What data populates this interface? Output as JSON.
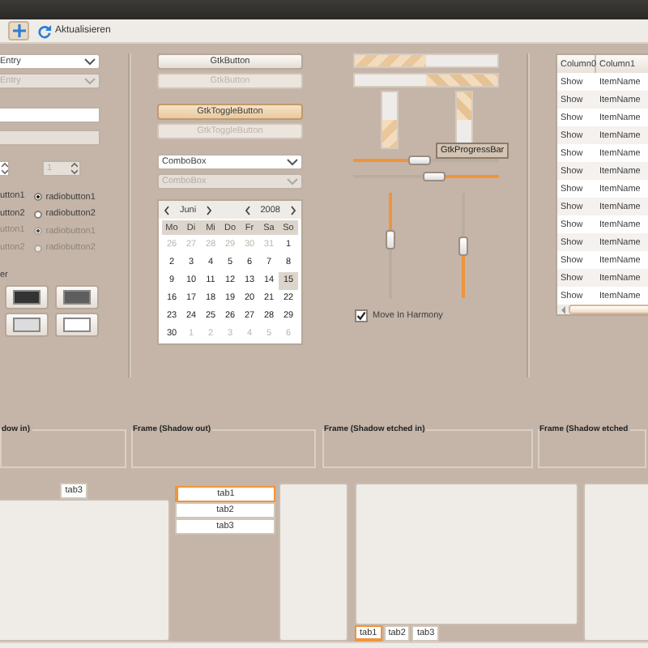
{
  "toolbar": [
    {
      "kind": "add",
      "selected": true
    },
    {
      "kind": "refresh",
      "label": "Aktualisieren",
      "selected": false
    }
  ],
  "combo_entries": [
    {
      "value": "Entry",
      "disabled": false
    },
    {
      "value": "Entry",
      "disabled": true
    }
  ],
  "entries": [
    {
      "disabled": false
    },
    {
      "disabled": true
    }
  ],
  "spin_buttons": [
    {
      "disabled": false
    },
    {
      "value": "1",
      "disabled": true
    }
  ],
  "check_labels": [
    {
      "label": "utton1",
      "disabled": false
    },
    {
      "label": "utton2",
      "disabled": false
    },
    {
      "label": "utton1",
      "disabled": true
    },
    {
      "label": "utton2",
      "disabled": true
    }
  ],
  "radios": [
    {
      "label": "radiobutton1",
      "selected": true,
      "disabled": false
    },
    {
      "label": "radiobutton2",
      "selected": false,
      "disabled": false
    },
    {
      "label": "radiobutton1",
      "selected": true,
      "disabled": true
    },
    {
      "label": "radiobutton2",
      "selected": false,
      "disabled": true
    }
  ],
  "color_label": "er",
  "swatches": [
    {
      "color": "#333333"
    },
    {
      "color": "#5e5e5e"
    },
    {
      "color": "#dcdcdc"
    },
    {
      "color": "#ffffff"
    }
  ],
  "buttons": [
    {
      "kind": "button",
      "label": "GtkButton",
      "disabled": false
    },
    {
      "kind": "button",
      "label": "GtkButton",
      "disabled": true
    },
    {
      "kind": "toggle",
      "label": "GtkToggleButton",
      "disabled": false,
      "selected": true
    },
    {
      "kind": "toggle",
      "label": "GtkToggleButton",
      "disabled": true,
      "selected": false
    }
  ],
  "combos": [
    {
      "value": "ComboBox",
      "disabled": false
    },
    {
      "value": "ComboBox",
      "disabled": true
    }
  ],
  "calendar": {
    "month": "Juni",
    "year": "2008",
    "weekdays": [
      "Mo",
      "Di",
      "Mi",
      "Do",
      "Fr",
      "Sa",
      "So"
    ],
    "days": [
      {
        "day": "26",
        "outside": true,
        "selected": false
      },
      {
        "day": "27",
        "outside": true,
        "selected": false
      },
      {
        "day": "28",
        "outside": true,
        "selected": false
      },
      {
        "day": "29",
        "outside": true,
        "selected": false
      },
      {
        "day": "30",
        "outside": true,
        "selected": false
      },
      {
        "day": "31",
        "outside": true,
        "selected": false
      },
      {
        "day": "1",
        "outside": false,
        "selected": false
      },
      {
        "day": "2",
        "outside": false,
        "selected": false
      },
      {
        "day": "3",
        "outside": false,
        "selected": false
      },
      {
        "day": "4",
        "outside": false,
        "selected": false
      },
      {
        "day": "5",
        "outside": false,
        "selected": false
      },
      {
        "day": "6",
        "outside": false,
        "selected": false
      },
      {
        "day": "7",
        "outside": false,
        "selected": false
      },
      {
        "day": "8",
        "outside": false,
        "selected": false
      },
      {
        "day": "9",
        "outside": false,
        "selected": false
      },
      {
        "day": "10",
        "outside": false,
        "selected": false
      },
      {
        "day": "11",
        "outside": false,
        "selected": false
      },
      {
        "day": "12",
        "outside": false,
        "selected": false
      },
      {
        "day": "13",
        "outside": false,
        "selected": false
      },
      {
        "day": "14",
        "outside": false,
        "selected": false
      },
      {
        "day": "15",
        "outside": false,
        "selected": true
      },
      {
        "day": "16",
        "outside": false,
        "selected": false
      },
      {
        "day": "17",
        "outside": false,
        "selected": false
      },
      {
        "day": "18",
        "outside": false,
        "selected": false
      },
      {
        "day": "19",
        "outside": false,
        "selected": false
      },
      {
        "day": "20",
        "outside": false,
        "selected": false
      },
      {
        "day": "21",
        "outside": false,
        "selected": false
      },
      {
        "day": "22",
        "outside": false,
        "selected": false
      },
      {
        "day": "23",
        "outside": false,
        "selected": false
      },
      {
        "day": "24",
        "outside": false,
        "selected": false
      },
      {
        "day": "25",
        "outside": false,
        "selected": false
      },
      {
        "day": "26",
        "outside": false,
        "selected": false
      },
      {
        "day": "27",
        "outside": false,
        "selected": false
      },
      {
        "day": "28",
        "outside": false,
        "selected": false
      },
      {
        "day": "29",
        "outside": false,
        "selected": false
      },
      {
        "day": "30",
        "outside": false,
        "selected": false
      },
      {
        "day": "1",
        "outside": true,
        "selected": false
      },
      {
        "day": "2",
        "outside": true,
        "selected": false
      },
      {
        "day": "3",
        "outside": true,
        "selected": false
      },
      {
        "day": "4",
        "outside": true,
        "selected": false
      },
      {
        "day": "5",
        "outside": true,
        "selected": false
      },
      {
        "day": "6",
        "outside": true,
        "selected": false
      }
    ]
  },
  "progress_bars": {
    "horizontal": [
      {
        "level": 0.5,
        "inverted": false
      },
      {
        "level": 0.5,
        "inverted": true
      }
    ],
    "vertical": [
      {
        "level": 0.5,
        "inverted": false
      },
      {
        "level": 0.5,
        "inverted": true
      }
    ]
  },
  "tooltip": "GtkProgressBar",
  "sliders": {
    "horizontal": [
      {
        "level": 0.45,
        "inverted": false
      },
      {
        "level": 0.55,
        "inverted": true
      }
    ],
    "vertical": [
      {
        "level": 0.45,
        "inverted": false
      },
      {
        "level": 0.5,
        "inverted": true
      }
    ]
  },
  "harmony": {
    "label": "Move In Harmony",
    "checked": true
  },
  "tree": {
    "columns": [
      "Column0",
      "Column1"
    ],
    "rows": [
      {
        "cells": [
          "Show",
          "ItemName"
        ]
      },
      {
        "cells": [
          "Show",
          "ItemName"
        ]
      },
      {
        "cells": [
          "Show",
          "ItemName"
        ]
      },
      {
        "cells": [
          "Show",
          "ItemName"
        ]
      },
      {
        "cells": [
          "Show",
          "ItemName"
        ]
      },
      {
        "cells": [
          "Show",
          "ItemName"
        ]
      },
      {
        "cells": [
          "Show",
          "ItemName"
        ]
      },
      {
        "cells": [
          "Show",
          "ItemName"
        ]
      },
      {
        "cells": [
          "Show",
          "ItemName"
        ]
      },
      {
        "cells": [
          "Show",
          "ItemName"
        ]
      },
      {
        "cells": [
          "Show",
          "ItemName"
        ]
      },
      {
        "cells": [
          "Show",
          "ItemName"
        ]
      },
      {
        "cells": [
          "Show",
          "ItemName"
        ]
      }
    ]
  },
  "frames": [
    {
      "label": "dow in)"
    },
    {
      "label": "Frame (Shadow out)"
    },
    {
      "label": "Frame (Shadow etched in)"
    },
    {
      "label": "Frame (Shadow etched"
    }
  ],
  "notebooks": [
    {
      "kind": "top",
      "tabs": [
        {
          "label": "tab3",
          "selected": false
        }
      ]
    },
    {
      "kind": "left",
      "tabs": [
        {
          "label": "tab1",
          "selected": true
        },
        {
          "label": "tab2",
          "selected": false
        },
        {
          "label": "tab3",
          "selected": false
        }
      ]
    },
    {
      "kind": "bottom",
      "tabs": [
        {
          "label": "tab1",
          "selected": true
        },
        {
          "label": "tab2",
          "selected": false
        },
        {
          "label": "tab3",
          "selected": false
        }
      ]
    },
    {
      "kind": "right"
    }
  ]
}
